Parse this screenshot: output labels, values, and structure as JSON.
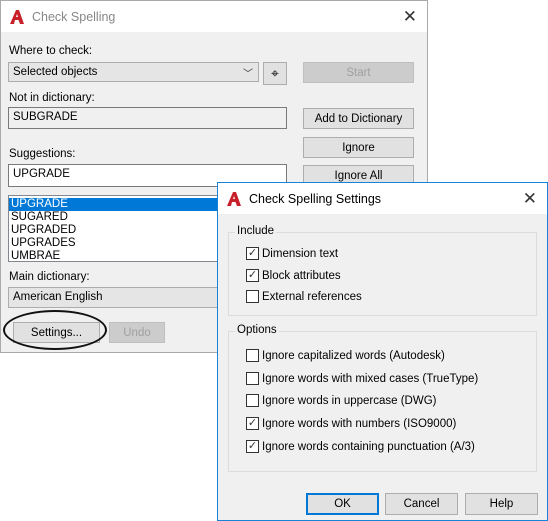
{
  "main": {
    "title": "Check Spelling",
    "where_label": "Where to check:",
    "where_value": "Selected objects",
    "start": "Start",
    "not_in_dict_label": "Not in dictionary:",
    "not_in_dict_value": "SUBGRADE",
    "add_to_dict": "Add to Dictionary",
    "ignore": "Ignore",
    "ignore_all": "Ignore All",
    "suggestions_label": "Suggestions:",
    "suggestion_value": "UPGRADE",
    "suggestions": [
      "UPGRADE",
      "SUGARED",
      "UPGRADED",
      "UPGRADES",
      "UMBRAE"
    ],
    "main_dict_label": "Main dictionary:",
    "main_dict_value": "American English",
    "settings": "Settings...",
    "undo": "Undo"
  },
  "settings": {
    "title": "Check Spelling Settings",
    "include_label": "Include",
    "include": [
      {
        "label": "Dimension text",
        "checked": true
      },
      {
        "label": "Block attributes",
        "checked": true
      },
      {
        "label": "External references",
        "checked": false
      }
    ],
    "options_label": "Options",
    "options": [
      {
        "label": "Ignore capitalized words (Autodesk)",
        "checked": false
      },
      {
        "label": "Ignore words with mixed cases (TrueType)",
        "checked": false
      },
      {
        "label": "Ignore words in uppercase (DWG)",
        "checked": false
      },
      {
        "label": "Ignore words with numbers (ISO9000)",
        "checked": true
      },
      {
        "label": "Ignore words containing punctuation (A/3)",
        "checked": true
      }
    ],
    "ok": "OK",
    "cancel": "Cancel",
    "help": "Help"
  },
  "colors": {
    "accent": "#0078d7",
    "logo": "#c8202a",
    "settings_border": "#1883d7"
  }
}
